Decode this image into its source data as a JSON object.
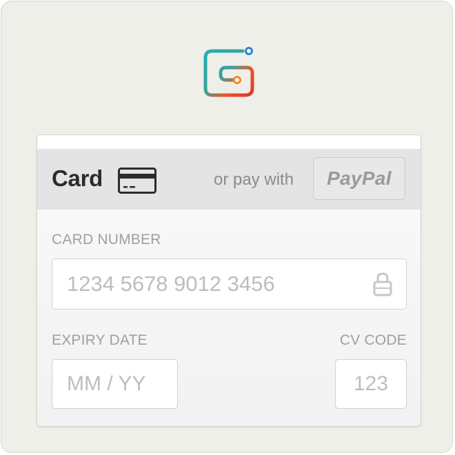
{
  "payment": {
    "tab_card_label": "Card",
    "or_pay_with": "or pay with",
    "paypal_label": "PayPal",
    "card_number": {
      "label": "CARD NUMBER",
      "placeholder": "1234 5678 9012 3456"
    },
    "expiry": {
      "label": "EXPIRY DATE",
      "placeholder": "MM / YY"
    },
    "cv": {
      "label": "CV CODE",
      "placeholder": "123"
    }
  },
  "icons": {
    "logo": "brand-logo-icon",
    "card": "credit-card-icon",
    "lock": "lock-icon"
  },
  "colors": {
    "logo_teal": "#1fb0b4",
    "logo_orange": "#e8562a",
    "logo_blue": "#2a86d0",
    "tab_background": "#e4e4e4",
    "page_background": "#efefea"
  }
}
